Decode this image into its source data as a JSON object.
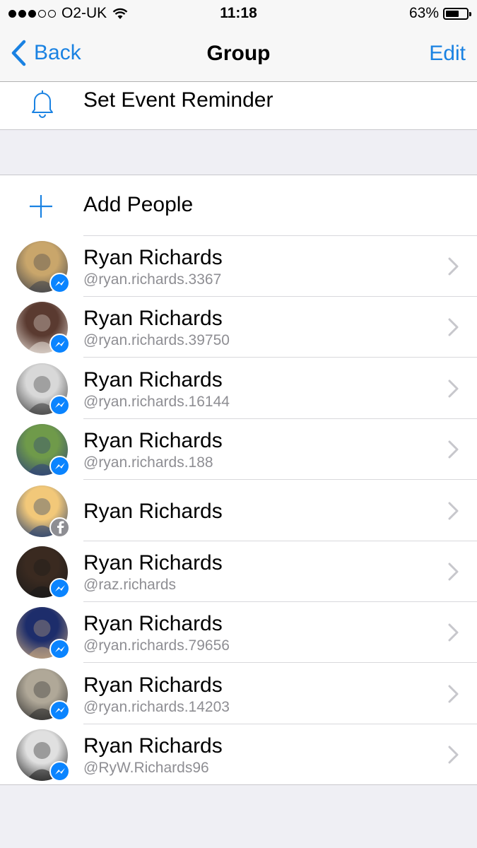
{
  "status_bar": {
    "carrier": "O2-UK",
    "signal_bars_filled": 3,
    "signal_bars_total": 5,
    "time": "11:18",
    "battery_percent_label": "63%",
    "battery_level": 0.63
  },
  "nav": {
    "back_label": "Back",
    "title": "Group",
    "edit_label": "Edit"
  },
  "reminder": {
    "icon": "bell-icon",
    "label": "Set Event Reminder"
  },
  "add_people": {
    "icon": "plus-icon",
    "label": "Add People"
  },
  "members": [
    {
      "name": "Ryan Richards",
      "handle": "@ryan.richards.3367",
      "badge": "messenger",
      "avatar_colors": [
        "#c9a66b",
        "#3b3f4a"
      ]
    },
    {
      "name": "Ryan Richards",
      "handle": "@ryan.richards.39750",
      "badge": "messenger",
      "avatar_colors": [
        "#5a3a30",
        "#e8e0d8"
      ]
    },
    {
      "name": "Ryan Richards",
      "handle": "@ryan.richards.16144",
      "badge": "messenger",
      "avatar_colors": [
        "#d8d8d8",
        "#3a3a3a"
      ]
    },
    {
      "name": "Ryan Richards",
      "handle": "@ryan.richards.188",
      "badge": "messenger",
      "avatar_colors": [
        "#6f9a4a",
        "#2b3e7a"
      ]
    },
    {
      "name": "Ryan Richards",
      "handle": "",
      "badge": "facebook",
      "avatar_colors": [
        "#f2c879",
        "#1f3b6e"
      ]
    },
    {
      "name": "Ryan Richards",
      "handle": "@raz.richards",
      "badge": "messenger",
      "avatar_colors": [
        "#3a2a20",
        "#1a1a1a"
      ]
    },
    {
      "name": "Ryan Richards",
      "handle": "@ryan.richards.79656",
      "badge": "messenger",
      "avatar_colors": [
        "#1d2d6b",
        "#c8a880"
      ]
    },
    {
      "name": "Ryan Richards",
      "handle": "@ryan.richards.14203",
      "badge": "messenger",
      "avatar_colors": [
        "#b0a898",
        "#2a2a2a"
      ]
    },
    {
      "name": "Ryan Richards",
      "handle": "@RyW.Richards96",
      "badge": "messenger",
      "avatar_colors": [
        "#e0e0e0",
        "#1a1a1a"
      ]
    }
  ],
  "colors": {
    "accent": "#1a82e2",
    "messenger_badge": "#0a84ff",
    "facebook_badge": "#8e8e93",
    "secondary_text": "#8e8e93",
    "grouped_background": "#efeff4"
  }
}
